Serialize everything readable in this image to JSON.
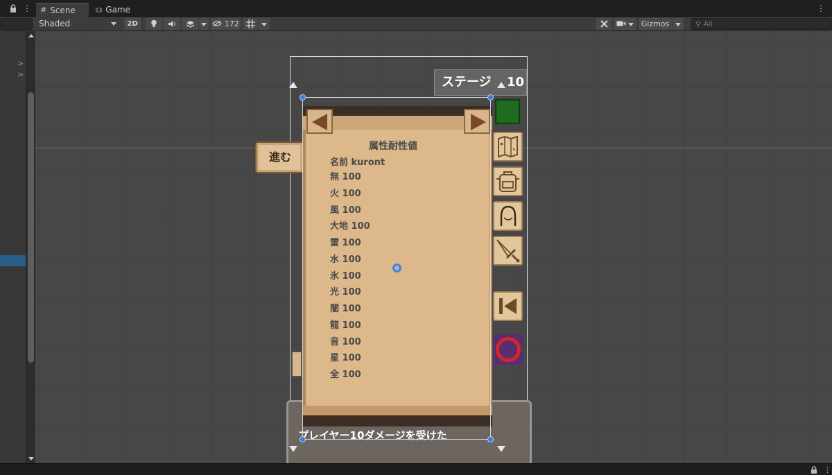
{
  "tabs": [
    {
      "label": "Scene",
      "icon": "grid-icon",
      "active": true
    },
    {
      "label": "Game",
      "icon": "gamepad-icon",
      "active": false
    }
  ],
  "toolbar": {
    "draw_mode": "Shaded",
    "mode_2d": "2D",
    "hidden_count": "172",
    "gizmos": "Gizmos",
    "search_placeholder": "All"
  },
  "game": {
    "stage_label": "ステージ",
    "stage_number": "10",
    "go_button_label": "進む",
    "panel_title": "属性耐性値",
    "name_line": "名前 kuront",
    "resistances": [
      "無 100",
      "火 100",
      "風 100",
      "大地 100",
      "雷 100",
      "水 100",
      "氷 100",
      "光 100",
      "闇 100",
      "龍 100",
      "音 100",
      "星 100",
      "全 100"
    ],
    "log_message": "プレイヤー10ダメージを受けた"
  },
  "colors": {
    "selection": "#3a7bdc",
    "parchment": "#dcb88a",
    "green_square": "#1f6b1f",
    "ring": "#d4262a"
  }
}
